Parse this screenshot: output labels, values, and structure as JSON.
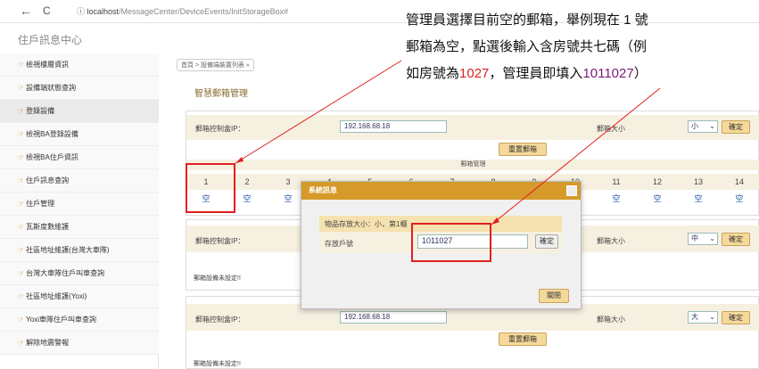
{
  "browser": {
    "back": "←",
    "reload": "C",
    "info": "ⓘ",
    "url_host": "localhost",
    "url_path": "/MessageCenter/DeviceEvents/InitStorageBox#"
  },
  "site_title": "住戶訊息中心",
  "sidebar": {
    "items": [
      {
        "label": "檢視樓層資訊"
      },
      {
        "label": "設備端狀態查詢"
      },
      {
        "label": "登錄設備"
      },
      {
        "label": "檢視BA登錄設備"
      },
      {
        "label": "檢視BA住戶資訊"
      },
      {
        "label": "住戶訊息查詢"
      },
      {
        "label": "住戶管理"
      },
      {
        "label": "瓦斯度數維護"
      },
      {
        "label": "社區地址維護(台灣大車隊)"
      },
      {
        "label": "台灣大車隊住戶叫車查詢"
      },
      {
        "label": "社區地址維護(Yoxi)"
      },
      {
        "label": "Yoxi車隊住戶叫車查詢"
      },
      {
        "label": "解除地震警報"
      }
    ]
  },
  "breadcrumb": "首頁 > 設備端裝置列表 »",
  "page_title": "智慧郵箱管理",
  "panel1": {
    "ip_label": "郵箱控制盒IP：",
    "ip_value": "192.168.68.18",
    "size_label": "郵箱大小",
    "size_value": "小",
    "confirm": "確定",
    "reset": "重置郵箱",
    "section": "郵箱管理",
    "box_numbers": [
      "1",
      "2",
      "3",
      "4",
      "5",
      "6",
      "7",
      "8",
      "9",
      "10",
      "11",
      "12",
      "13",
      "14"
    ],
    "box_status": [
      "空",
      "空",
      "空",
      "",
      "",
      "",
      "",
      "",
      "",
      "",
      "空",
      "空",
      "空",
      "空"
    ]
  },
  "panel2": {
    "ip_label": "郵箱控制盒IP：",
    "size_label": "郵箱大小",
    "size_value": "中",
    "confirm": "確定",
    "note": "郵箱設備未設定!!"
  },
  "panel3": {
    "ip_label": "郵箱控制盒IP：",
    "ip_value": "192.168.68.18",
    "size_label": "郵箱大小",
    "size_value": "大",
    "confirm": "確定",
    "reset": "重置郵箱",
    "note": "郵箱設備未設定!!"
  },
  "dialog": {
    "title": "系統訊息",
    "info": "物品存放大小：小，第1櫃",
    "room_label": "存放戶號",
    "room_value": "1011027",
    "confirm": "確定",
    "close": "關閉"
  },
  "callout": {
    "l1": "管理員選擇目前空的郵箱，舉例現在 1 號",
    "l2": "郵箱為空，點選後輸入含房號共七碼（例",
    "l3a": "如房號為",
    "l3b": "1027",
    "l3c": "，管理員即填入",
    "l3d": "1011027",
    "l3e": "）"
  },
  "colors": {
    "accent": "#d59a2a",
    "highlight": "#e02020",
    "purple": "#7a1a7a"
  }
}
